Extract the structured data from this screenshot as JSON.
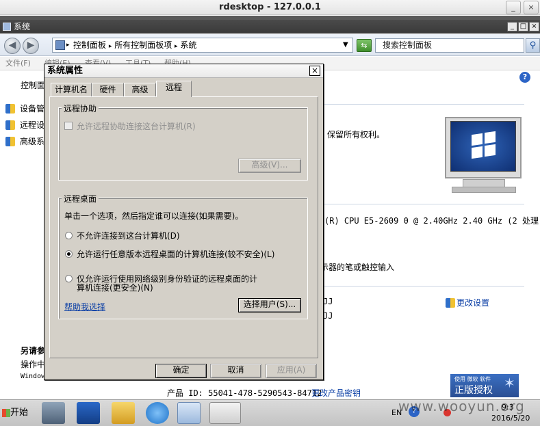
{
  "rdesktop": {
    "title": "rdesktop - 127.0.0.1",
    "btn_minimize": "_",
    "btn_close": "×"
  },
  "window": {
    "title": "系统",
    "btn_min": "_",
    "btn_max": "□",
    "btn_close": "×"
  },
  "nav": {
    "back": "◀",
    "forward": "▶"
  },
  "address": {
    "crumb1": "控制面板",
    "crumb2": "所有控制面板项",
    "crumb3": "系统",
    "sep": "▸"
  },
  "search": {
    "placeholder": "搜索控制面板"
  },
  "menu": {
    "file": "文件(F)",
    "edit": "编辑(E)",
    "view": "查看(V)",
    "tools": "工具(T)",
    "help": "帮助(H)"
  },
  "left_pane": {
    "home": "控制面",
    "links": [
      "设备管",
      "远程设",
      "高级系"
    ],
    "see_also_title": "另请参",
    "see_also_item": "操作中",
    "windows_label": "Window"
  },
  "right_pane": {
    "copyright": "保留所有权利。",
    "cpu": "(R) CPU E5-2609 0 @ 2.40GHz   2.40 GHz  (2 处理",
    "pen": "示器的笔或触控输入",
    "name1": "JJ",
    "name2": "JJ",
    "change_settings": "更改设置",
    "product_id": "产品 ID: 55041-478-5290543-84712",
    "change_key": "更改产品密钥",
    "genuine_top": "使用 微软 软件",
    "genuine": "正版授权"
  },
  "dialog": {
    "title": "系统属性",
    "close": "×",
    "tabs": [
      "计算机名",
      "硬件",
      "高级",
      "远程"
    ],
    "remote_assist": {
      "legend": "远程协助",
      "allow_label": "允许远程协助连接这台计算机(R)",
      "advanced_btn": "高级(V)..."
    },
    "remote_desktop": {
      "legend": "远程桌面",
      "intro": "单击一个选项，然后指定谁可以连接(如果需要)。",
      "option1": "不允许连接到这台计算机(D)",
      "option2": "允许运行任意版本远程桌面的计算机连接(较不安全)(L)",
      "option3_line1": "仅允许运行使用网络级别身份验证的远程桌面的计",
      "option3_line2": "算机连接(更安全)(N)",
      "help_link": "帮助我选择",
      "select_users_btn": "选择用户(S)..."
    },
    "ok": "确定",
    "cancel": "取消",
    "apply": "应用(A)"
  },
  "taskbar": {
    "start": "开始",
    "lang": "EN",
    "time": "9:3",
    "date": "2016/5/20"
  },
  "watermark": "www.wooyun.org"
}
